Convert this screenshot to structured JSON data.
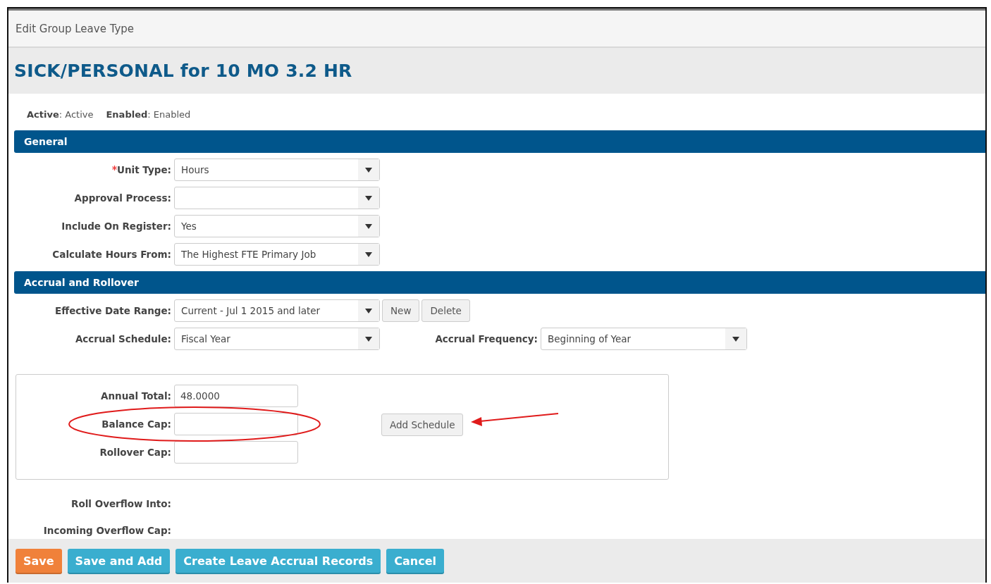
{
  "dialog": {
    "title": "Edit Group Leave Type"
  },
  "heading": "SICK/PERSONAL for 10 MO 3.2 HR",
  "status": [
    {
      "label": "Active",
      "value": ": Active"
    },
    {
      "label": "Enabled",
      "value": ": Enabled"
    }
  ],
  "general": {
    "title": "General",
    "fields": [
      {
        "label": "Unit Type:",
        "required": true,
        "value": "Hours"
      },
      {
        "label": "Approval Process:",
        "required": false
      },
      {
        "label": "Include On Register:",
        "required": false,
        "value": "Yes"
      },
      {
        "label": "Calculate Hours From:",
        "required": false,
        "value": "The Highest FTE Primary Job"
      }
    ]
  },
  "accrual": {
    "title": "Accrual and Rollover",
    "date_range": {
      "label": "Effective Date Range:",
      "value": "Current - Jul  1 2015 and later",
      "buttons": [
        "New",
        "Delete"
      ]
    },
    "schedule": {
      "label": "Accrual Schedule:",
      "value": "Fiscal Year"
    },
    "frequency": {
      "label": "Accrual Frequency:",
      "value": "Beginning of Year"
    },
    "schedule_box": {
      "fields": [
        {
          "label": "Annual Total:",
          "value": "48.0000"
        },
        {
          "label": "Balance Cap:"
        },
        {
          "label": "Rollover Cap:"
        }
      ],
      "button": "Add Schedule"
    },
    "overflow_labels": [
      "Roll Overflow Into:",
      "Incoming Overflow Cap:"
    ]
  },
  "footer": {
    "buttons": [
      {
        "label": "Save",
        "kind": "primary"
      },
      {
        "label": "Save and Add",
        "kind": "info"
      },
      {
        "label": "Create Leave Accrual Records",
        "kind": "info"
      },
      {
        "label": "Cancel",
        "kind": "info"
      }
    ]
  },
  "annotations": [
    {
      "kind": "ellipse"
    },
    {
      "kind": "arrow"
    }
  ]
}
